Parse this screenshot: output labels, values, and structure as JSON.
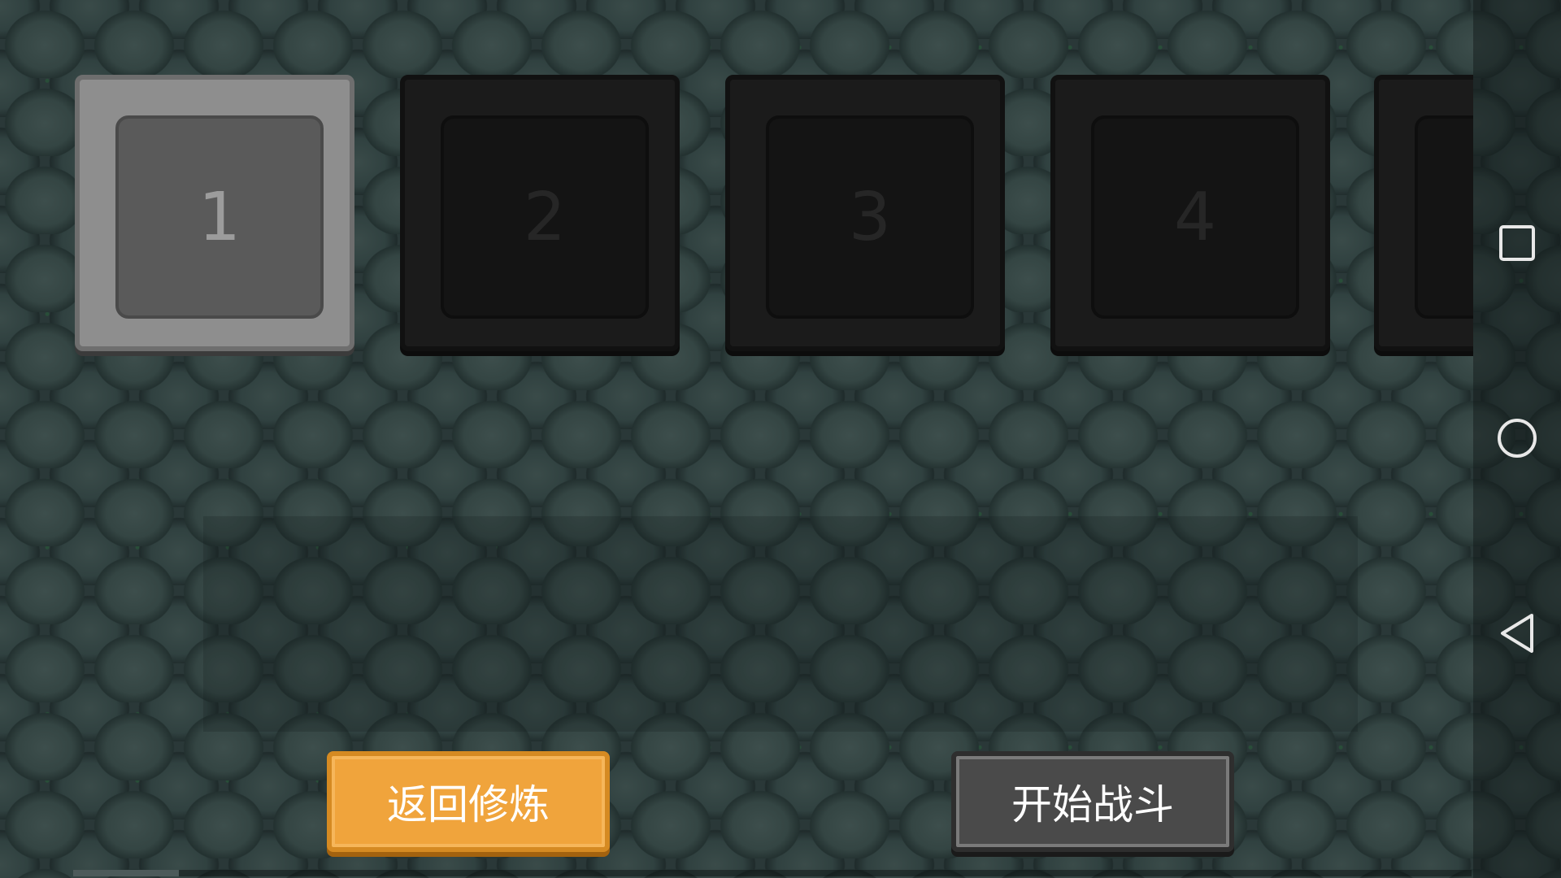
{
  "level_slots": [
    {
      "number": "1",
      "state": "unlocked"
    },
    {
      "number": "2",
      "state": "locked"
    },
    {
      "number": "3",
      "state": "locked"
    },
    {
      "number": "4",
      "state": "locked"
    },
    {
      "number": "",
      "state": "locked"
    }
  ],
  "buttons": {
    "back_label": "返回修炼",
    "start_label": "开始战斗"
  },
  "nav_bar": {
    "icons": [
      "recent-apps-icon",
      "home-icon",
      "back-icon"
    ]
  },
  "colors": {
    "accent_orange": "#f0a43c",
    "button_gray": "#4a4a4a",
    "slot_active": "#8e8e8e",
    "slot_locked": "#1b1b1b"
  }
}
